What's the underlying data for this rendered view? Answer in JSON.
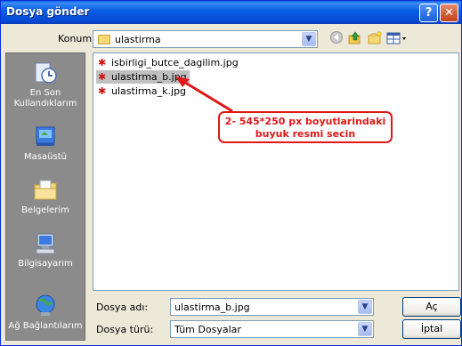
{
  "window": {
    "title": "Dosya gönder",
    "help_label": "?",
    "close_label": "✕"
  },
  "location": {
    "label": "Konum:",
    "value": "ulastirma"
  },
  "toolbar": [
    "back-icon",
    "up-folder-icon",
    "new-folder-icon",
    "view-menu-icon"
  ],
  "places": [
    {
      "name": "recent",
      "label": "En Son Kullandıklarım",
      "icon": "recent-documents-icon"
    },
    {
      "name": "desktop",
      "label": "Masaüstü",
      "icon": "desktop-icon"
    },
    {
      "name": "documents",
      "label": "Belgelerim",
      "icon": "my-documents-icon"
    },
    {
      "name": "computer",
      "label": "Bilgisayarım",
      "icon": "my-computer-icon"
    },
    {
      "name": "network",
      "label": "Ağ Bağlantılarım",
      "icon": "network-icon"
    }
  ],
  "files": [
    {
      "name": "isbirligi_butce_dagilim.jpg",
      "selected": false
    },
    {
      "name": "ulastirma_b.jpg",
      "selected": true
    },
    {
      "name": "ulastirma_k.jpg",
      "selected": false
    }
  ],
  "annotation": {
    "line1": "2- 545*250 px boyutlarindaki",
    "line2": "buyuk resmi secin",
    "color": "#e01818"
  },
  "filename": {
    "label": "Dosya adı:",
    "value": "ulastirma_b.jpg"
  },
  "filetype": {
    "label": "Dosya türü:",
    "value": "Tüm Dosyalar"
  },
  "buttons": {
    "open": "Aç",
    "cancel": "İptal"
  }
}
